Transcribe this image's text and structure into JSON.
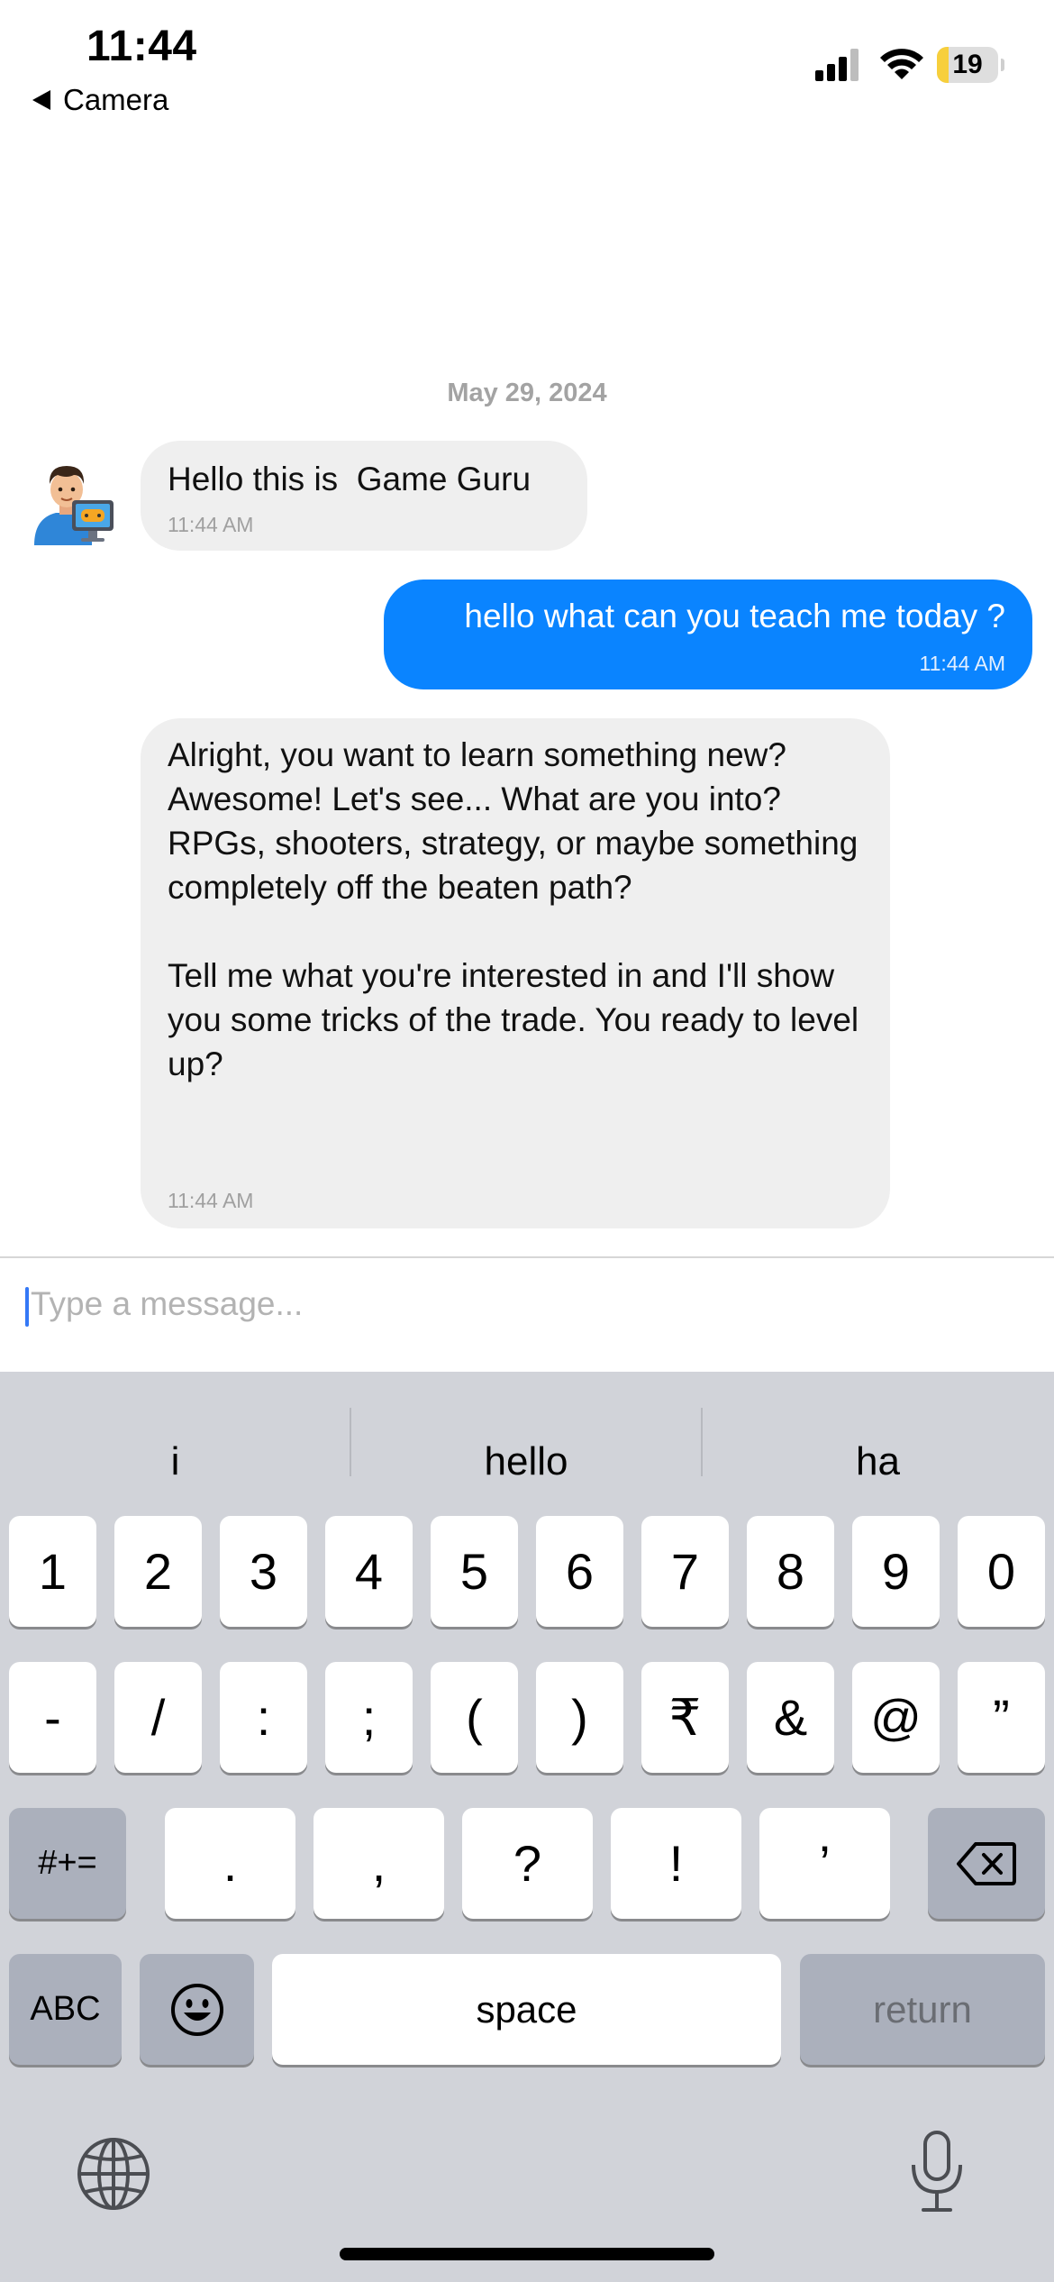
{
  "status_bar": {
    "time": "11:44",
    "back_label": "Camera",
    "battery_level": "19",
    "battery_fraction": 0.19,
    "icons": [
      "signal-icon",
      "wifi-icon",
      "battery-icon"
    ]
  },
  "chat": {
    "date": "May 29, 2024",
    "messages": [
      {
        "sender": "bot",
        "text": "Hello this is  Game Guru",
        "time": "11:44 AM"
      },
      {
        "sender": "user",
        "text": "hello what can you teach me today ?",
        "time": "11:44 AM"
      },
      {
        "sender": "bot",
        "text": "Alright, you want to learn something new? Awesome! Let's see... What are you into? RPGs, shooters, strategy, or maybe something completely off the beaten path?\n\nTell me what you're interested in and I'll show you some tricks of the trade.  You ready to level up?",
        "time": "11:44 AM"
      }
    ]
  },
  "composer": {
    "placeholder": "Type a message...",
    "value": ""
  },
  "keyboard": {
    "suggestions": [
      "i",
      "hello",
      "ha"
    ],
    "row1": [
      "1",
      "2",
      "3",
      "4",
      "5",
      "6",
      "7",
      "8",
      "9",
      "0"
    ],
    "row2": [
      "-",
      "/",
      ":",
      ";",
      "(",
      ")",
      "₹",
      "&",
      "@",
      "”"
    ],
    "row3": {
      "symbols_toggle": "#+=",
      "keys": [
        ".",
        ",",
        "?",
        "!",
        "’"
      ],
      "delete_icon": "backspace-icon"
    },
    "row4": {
      "abc": "ABC",
      "emoji_icon": "emoji-icon",
      "space": "space",
      "return": "return"
    },
    "bottom_icons": [
      "globe-icon",
      "microphone-icon"
    ]
  },
  "colors": {
    "user_bubble": "#0a84ff",
    "bot_bubble": "#efefef",
    "keyboard_bg": "#d1d3d9",
    "battery_fill": "#f7cf3c",
    "caret": "#3478f6"
  }
}
